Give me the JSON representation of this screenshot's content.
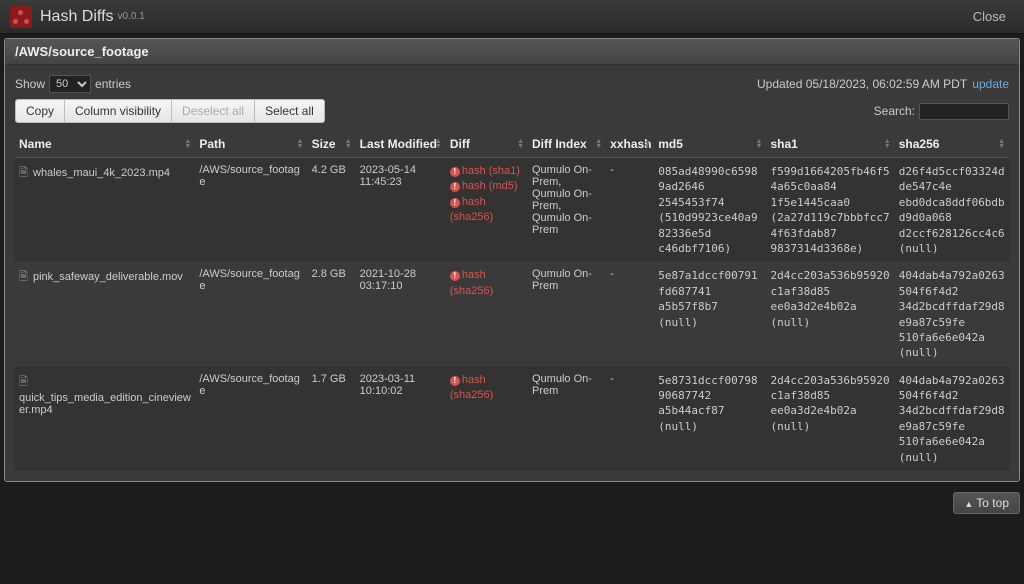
{
  "header": {
    "title": "Hash Diffs",
    "version": "v0.0.1",
    "close": "Close"
  },
  "panel": {
    "title": "/AWS/source_footage"
  },
  "controls": {
    "show_label": "Show",
    "entries_label": "entries",
    "page_size": "50",
    "updated_prefix": "Updated ",
    "updated_time": "05/18/2023, 06:02:59 AM PDT",
    "update_link": "update"
  },
  "toolbar": {
    "copy": "Copy",
    "colvis": "Column visibility",
    "deselect": "Deselect all",
    "select": "Select all",
    "search_label": "Search:"
  },
  "columns": {
    "name": "Name",
    "path": "Path",
    "size": "Size",
    "modified": "Last Modified",
    "diff": "Diff",
    "diff_index": "Diff Index",
    "xxhash": "xxhash",
    "md5": "md5",
    "sha1": "sha1",
    "sha256": "sha256"
  },
  "rows": [
    {
      "name": "whales_maui_4k_2023.mp4",
      "path": "/AWS/source_footage",
      "size": "4.2 GB",
      "modified": "2023-05-14 11:45:23",
      "diffs": [
        "hash (sha1)",
        "hash (md5)",
        "hash (sha256)"
      ],
      "diff_index": "Qumulo On-Prem, Qumulo On-Prem, Qumulo On-Prem",
      "xxhash": "-",
      "md5": "085ad48990c65989ad2646 2545453f74 (510d9923ce40a982336e5d c46dbf7106)",
      "sha1": "f599d1664205fb46f54a65c0aa84 1f5e1445caa0 (2a27d119c7bbbfcc74f63fdab87 9837314d3368e)",
      "sha256": "d26f4d5ccf03324dde547c4e ebd0dca8ddf06bdbd9d0a068 d2ccf628126cc4c6 (null)"
    },
    {
      "name": "pink_safeway_deliverable.mov",
      "path": "/AWS/source_footage",
      "size": "2.8 GB",
      "modified": "2021-10-28 03:17:10",
      "diffs": [
        "hash (sha256)"
      ],
      "diff_index": "Qumulo On-Prem",
      "xxhash": "-",
      "md5": "5e87a1dccf00791fd687741 a5b57f8b7 (null)",
      "sha1": "2d4cc203a536b95920c1af38d85 ee0a3d2e4b02a (null)",
      "sha256": "404dab4a792a0263504f6f4d2 34d2bcdffdaf29d8e9a87c59fe 510fa6e6e042a (null)"
    },
    {
      "name": "quick_tips_media_edition_cineviewer.mp4",
      "path": "/AWS/source_footage",
      "size": "1.7 GB",
      "modified": "2023-03-11 10:10:02",
      "diffs": [
        "hash (sha256)"
      ],
      "diff_index": "Qumulo On-Prem",
      "xxhash": "-",
      "md5": "5e8731dccf0079890687742 a5b44acf87 (null)",
      "sha1": "2d4cc203a536b95920c1af38d85 ee0a3d2e4b02a (null)",
      "sha256": "404dab4a792a0263504f6f4d2 34d2bcdffdaf29d8e9a87c59fe 510fa6e6e042a (null)"
    }
  ],
  "to_top": "To top"
}
